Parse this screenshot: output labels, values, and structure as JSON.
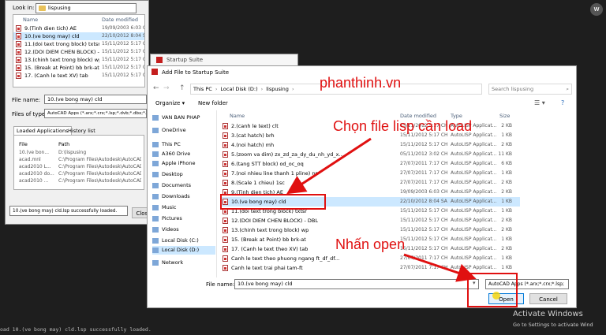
{
  "back_window": {
    "look_in_label": "Look in:",
    "look_in_value": "lispusing",
    "col_name": "Name",
    "col_date": "Date modified",
    "files": [
      {
        "name": "9.(Tinh dien tich) AE",
        "date": "19/09/2003 6:03 CH"
      },
      {
        "name": "10.(ve bong may) cld",
        "date": "22/10/2012 8:04 SA"
      },
      {
        "name": "11.(doi text trong block) txtsr",
        "date": "15/11/2012 5:17 CH"
      },
      {
        "name": "12.(DOI DIEM CHEN BLOCK) - DBL",
        "date": "15/11/2012 5:17 CH"
      },
      {
        "name": "13.(chinh text trong block) wp",
        "date": "15/11/2012 5:17 CH"
      },
      {
        "name": "15. (Break at Point) bb brk-at",
        "date": "15/11/2012 5:17 CH"
      },
      {
        "name": "17. (Canh le text XV) tab",
        "date": "15/11/2012 5:17 CH"
      }
    ],
    "file_name_label": "File name:",
    "file_name_value": "10.(ve bong may) cld",
    "files_type_label": "Files of type:",
    "files_type_value": "AutoCAD Apps (*.arx;*.crx;*.lsp;*.dvb;*.dbx;*.",
    "tab_loaded": "Loaded Applications",
    "tab_history": "History list",
    "loaded_col_file": "File",
    "loaded_col_path": "Path",
    "loaded": [
      {
        "file": "10.(ve bon...",
        "path": "D:\\lispusing"
      },
      {
        "file": "acad.mnl",
        "path": "C:\\Program Files\\Autodesk\\AutoCAD"
      },
      {
        "file": "acad2010 L...",
        "path": "C:\\Program Files\\Autodesk\\AutoCAD"
      },
      {
        "file": "acad2010 do...",
        "path": "C:\\Program Files\\Autodesk\\AutoCAD"
      },
      {
        "file": "acad2010 ...",
        "path": "C:\\Program Files\\Autodesk\\AutoCAD"
      }
    ],
    "status": "10.(ve bong may) cld.lsp successfully loaded.",
    "close_label": "Close"
  },
  "startup_suite": {
    "title": "Startup Suite"
  },
  "dialog": {
    "title": "Add File to Startup Suite",
    "breadcrumb": [
      "This PC",
      "Local Disk (D:)",
      "lispusing"
    ],
    "search_placeholder": "Search lispusing",
    "organize_label": "Organize",
    "new_folder_label": "New folder",
    "nav_items": [
      {
        "label": "VAN BAN PHAP",
        "icon": "folder-icon"
      },
      {
        "label": "OneDrive",
        "icon": "cloud-icon"
      },
      {
        "label": "This PC",
        "icon": "computer-icon"
      },
      {
        "label": "A360 Drive",
        "icon": "drive-icon"
      },
      {
        "label": "Apple iPhone",
        "icon": "phone-icon"
      },
      {
        "label": "Desktop",
        "icon": "desktop-icon"
      },
      {
        "label": "Documents",
        "icon": "documents-icon"
      },
      {
        "label": "Downloads",
        "icon": "downloads-icon"
      },
      {
        "label": "Music",
        "icon": "music-icon"
      },
      {
        "label": "Pictures",
        "icon": "pictures-icon"
      },
      {
        "label": "Videos",
        "icon": "videos-icon"
      },
      {
        "label": "Local Disk (C:)",
        "icon": "disk-icon"
      },
      {
        "label": "Local Disk (D:)",
        "icon": "disk-icon"
      },
      {
        "label": "Network",
        "icon": "network-icon"
      }
    ],
    "files": [
      {
        "name": "2.(canh le text) clt",
        "date": "15/11/2012 5:17 CH",
        "type": "AutoLISP Applicat...",
        "size": "2 KB"
      },
      {
        "name": "3.(cat hatch) brh",
        "date": "15/11/2012 5:17 CH",
        "type": "AutoLISP Applicat...",
        "size": "1 KB"
      },
      {
        "name": "4.(noi hatch) mh",
        "date": "15/11/2012 5:17 CH",
        "type": "AutoLISP Applicat...",
        "size": "2 KB"
      },
      {
        "name": "5.(zoom va dim) zx_zd_za_dy_du_nh_yd_x...",
        "date": "05/11/2012 3:02 CH",
        "type": "AutoLISP Applicat...",
        "size": "11 KB"
      },
      {
        "name": "6.(tang STT block) od_oc_oq",
        "date": "27/07/2011 7:17 CH",
        "type": "AutoLISP Applicat...",
        "size": "6 KB"
      },
      {
        "name": "7.(noi nhieu line thanh 1 pline) nn",
        "date": "27/07/2011 7:17 CH",
        "type": "AutoLISP Applicat...",
        "size": "1 KB"
      },
      {
        "name": "8.(Scale 1 chieu) 1sc",
        "date": "27/07/2011 7:17 CH",
        "type": "AutoLISP Applicat...",
        "size": "2 KB"
      },
      {
        "name": "9.(Tinh dien tich) AE",
        "date": "19/09/2003 6:03 CH",
        "type": "AutoLISP Applicat...",
        "size": "2 KB"
      },
      {
        "name": "10.(ve bong may) cld",
        "date": "22/10/2012 8:04 SA",
        "type": "AutoLISP Applicat...",
        "size": "1 KB"
      },
      {
        "name": "11.(doi text trong block) txtsr",
        "date": "15/11/2012 5:17 CH",
        "type": "AutoLISP Applicat...",
        "size": "1 KB"
      },
      {
        "name": "12.(DOI DIEM CHEN BLOCK) - DBL",
        "date": "15/11/2012 5:17 CH",
        "type": "AutoLISP Applicat...",
        "size": "2 KB"
      },
      {
        "name": "13.(chinh text trong block) wp",
        "date": "15/11/2012 5:17 CH",
        "type": "AutoLISP Applicat...",
        "size": "2 KB"
      },
      {
        "name": "15. (Break at Point) bb brk-at",
        "date": "15/11/2012 5:17 CH",
        "type": "AutoLISP Applicat...",
        "size": "1 KB"
      },
      {
        "name": "17. (Canh le text theo XV) tab",
        "date": "15/11/2012 5:17 CH",
        "type": "AutoLISP Applicat...",
        "size": "2 KB"
      },
      {
        "name": "Canh le text theo phuong ngang ft_df_df...",
        "date": "27/07/2011 7:17 CH",
        "type": "AutoLISP Applicat...",
        "size": "1 KB"
      },
      {
        "name": "Canh le text trai phai tam-ft",
        "date": "27/07/2011 7:17 CH",
        "type": "AutoLISP Applicat...",
        "size": "1 KB"
      }
    ],
    "selected_index": 8,
    "file_name_label": "File name:",
    "file_name_value": "10.(ve bong may) cld",
    "file_type_value": "AutoCAD Apps (*.arx;*.crx;*.lsp;",
    "open_label": "Open",
    "cancel_label": "Cancel"
  },
  "annotations": {
    "brand": "phanthinh.vn",
    "choose_lisp": "Chọn file lisp cần load",
    "press_open": "Nhấn open"
  },
  "command_line": "oad 10.(ve bong may) cld.lsp successfully loaded.",
  "watermark": {
    "line1": "Activate Windows",
    "line2": "Go to Settings to activate Wind"
  }
}
